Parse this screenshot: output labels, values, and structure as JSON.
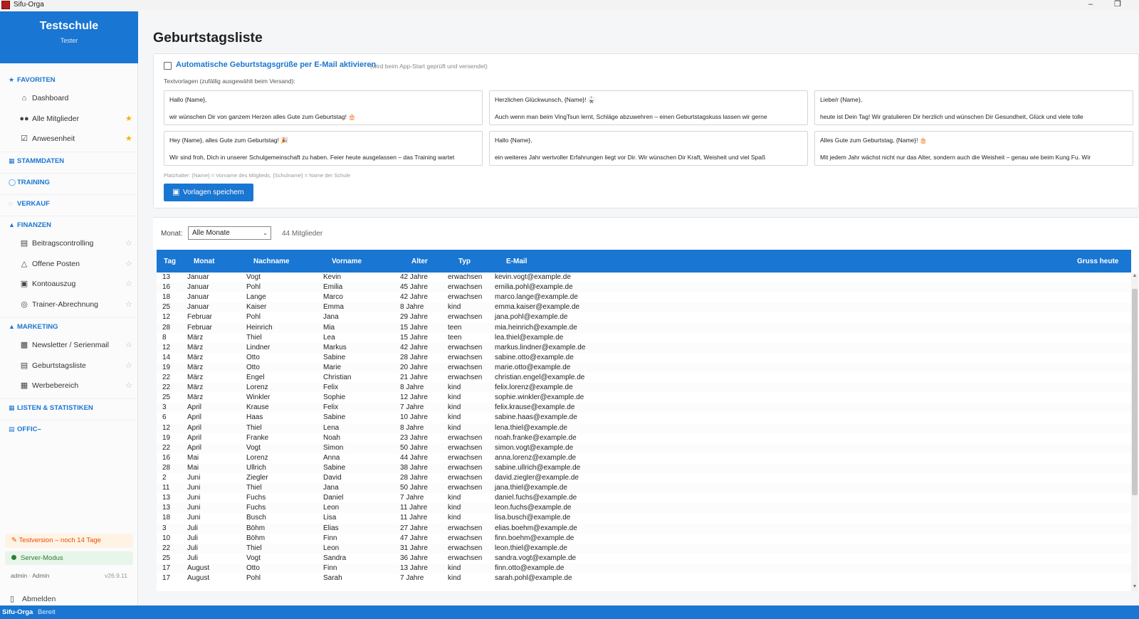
{
  "window": {
    "title": "Sifu-Orga"
  },
  "sidebar": {
    "school_name": "Testschule",
    "user_role": "Tester",
    "sections": {
      "favoriten": "FAVORITEN",
      "stammdaten": "STAMMDATEN",
      "training": "TRAINING",
      "verkauf": "VERKAUF",
      "finanzen": "FINANZEN",
      "marketing": "MARKETING",
      "listen": "LISTEN & STATISTIKEN",
      "office": "OFFIC–"
    },
    "favorites": [
      {
        "label": "Dashboard",
        "icon": "home-icon",
        "starred": false
      },
      {
        "label": "Alle Mitglieder",
        "icon": "users-icon",
        "starred": true
      },
      {
        "label": "Anwesenheit",
        "icon": "checkbox-icon",
        "starred": true
      }
    ],
    "finanzen_items": [
      {
        "label": "Beitragscontrolling",
        "icon": "card-icon"
      },
      {
        "label": "Offene Posten",
        "icon": "warning-icon"
      },
      {
        "label": "Kontoauszug",
        "icon": "statement-icon"
      },
      {
        "label": "Trainer-Abrechnung",
        "icon": "coin-icon"
      }
    ],
    "marketing_items": [
      {
        "label": "Newsletter / Serienmail",
        "icon": "newsletter-icon"
      },
      {
        "label": "Geburtstagsliste",
        "icon": "cake-icon"
      },
      {
        "label": "Werbebereich",
        "icon": "ad-icon"
      }
    ],
    "trial_text": "Testversion – noch 14 Tage",
    "server_text": "Server-Modus",
    "user_line": "admin · Admin",
    "version": "v26.9.11",
    "logout_label": "Abmelden"
  },
  "main": {
    "title": "Geburtstagsliste",
    "auto_greeting_label": "Automatische Geburtstagsgrüße per E-Mail aktivieren",
    "auto_greeting_hint": "(wird beim App-Start geprüft und versendet)",
    "auto_greeting_checked": false,
    "templates_label": "Textvorlagen (zufällig ausgewählt beim Versand):",
    "templates": [
      {
        "line1": "Hallo {Name},",
        "line2": "wir wünschen Dir von ganzem Herzen alles Gute zum Geburtstag! 🎂"
      },
      {
        "line1": "Herzlichen Glückwunsch, {Name}! 🥋",
        "line2": "Auch wenn man beim VingTsun lernt, Schläge abzuwehren – einen Geburtstagskuss lassen wir gerne"
      },
      {
        "line1": "Liebe/r {Name},",
        "line2": "heute ist Dein Tag! Wir gratulieren Dir herzlich und wünschen Dir Gesundheit, Glück und viele tolle"
      },
      {
        "line1": "Hey {Name}, alles Gute zum Geburtstag! 🎉",
        "line2": "Wir sind froh, Dich in unserer Schulgemeinschaft zu haben. Feier heute ausgelassen – das Training wartet"
      },
      {
        "line1": "Hallo {Name},",
        "line2": "ein weiteres Jahr wertvoller Erfahrungen liegt vor Dir. Wir wünschen Dir Kraft, Weisheit und viel Spaß"
      },
      {
        "line1": "Alles Gute zum Geburtstag, {Name}! 🎂",
        "line2": "Mit jedem Jahr wächst nicht nur das Alter, sondern auch die Weisheit – genau wie beim Kung Fu. Wir"
      }
    ],
    "placeholder_hint": "Platzhalter: {Name} = Vorname des Mitglieds, {Schulname} = Name der Schule",
    "save_button": "Vorlagen speichern",
    "filter": {
      "month_label": "Monat:",
      "month_value": "Alle Monate",
      "count": "44 Mitglieder"
    },
    "table": {
      "columns": [
        "Tag",
        "Monat",
        "Nachname",
        "Vorname",
        "Alter",
        "Typ",
        "E-Mail",
        "Gruss heute"
      ],
      "rows": [
        [
          "13",
          "Januar",
          "Vogt",
          "Kevin",
          "42 Jahre",
          "erwachsen",
          "kevin.vogt@example.de",
          ""
        ],
        [
          "16",
          "Januar",
          "Pohl",
          "Emilia",
          "45 Jahre",
          "erwachsen",
          "emilia.pohl@example.de",
          ""
        ],
        [
          "18",
          "Januar",
          "Lange",
          "Marco",
          "42 Jahre",
          "erwachsen",
          "marco.lange@example.de",
          ""
        ],
        [
          "25",
          "Januar",
          "Kaiser",
          "Emma",
          "8 Jahre",
          "kind",
          "emma.kaiser@example.de",
          ""
        ],
        [
          "12",
          "Februar",
          "Pohl",
          "Jana",
          "29 Jahre",
          "erwachsen",
          "jana.pohl@example.de",
          ""
        ],
        [
          "28",
          "Februar",
          "Heinrich",
          "Mia",
          "15 Jahre",
          "teen",
          "mia.heinrich@example.de",
          ""
        ],
        [
          "8",
          "März",
          "Thiel",
          "Lea",
          "15 Jahre",
          "teen",
          "lea.thiel@example.de",
          ""
        ],
        [
          "12",
          "März",
          "Lindner",
          "Markus",
          "42 Jahre",
          "erwachsen",
          "markus.lindner@example.de",
          ""
        ],
        [
          "14",
          "März",
          "Otto",
          "Sabine",
          "28 Jahre",
          "erwachsen",
          "sabine.otto@example.de",
          ""
        ],
        [
          "19",
          "März",
          "Otto",
          "Marie",
          "20 Jahre",
          "erwachsen",
          "marie.otto@example.de",
          ""
        ],
        [
          "22",
          "März",
          "Engel",
          "Christian",
          "21 Jahre",
          "erwachsen",
          "christian.engel@example.de",
          ""
        ],
        [
          "22",
          "März",
          "Lorenz",
          "Felix",
          "8 Jahre",
          "kind",
          "felix.lorenz@example.de",
          ""
        ],
        [
          "25",
          "März",
          "Winkler",
          "Sophie",
          "12 Jahre",
          "kind",
          "sophie.winkler@example.de",
          ""
        ],
        [
          "3",
          "April",
          "Krause",
          "Felix",
          "7 Jahre",
          "kind",
          "felix.krause@example.de",
          ""
        ],
        [
          "6",
          "April",
          "Haas",
          "Sabine",
          "10 Jahre",
          "kind",
          "sabine.haas@example.de",
          ""
        ],
        [
          "12",
          "April",
          "Thiel",
          "Lena",
          "8 Jahre",
          "kind",
          "lena.thiel@example.de",
          ""
        ],
        [
          "19",
          "April",
          "Franke",
          "Noah",
          "23 Jahre",
          "erwachsen",
          "noah.franke@example.de",
          ""
        ],
        [
          "22",
          "April",
          "Vogt",
          "Simon",
          "50 Jahre",
          "erwachsen",
          "simon.vogt@example.de",
          ""
        ],
        [
          "16",
          "Mai",
          "Lorenz",
          "Anna",
          "44 Jahre",
          "erwachsen",
          "anna.lorenz@example.de",
          ""
        ],
        [
          "28",
          "Mai",
          "Ullrich",
          "Sabine",
          "38 Jahre",
          "erwachsen",
          "sabine.ullrich@example.de",
          ""
        ],
        [
          "2",
          "Juni",
          "Ziegler",
          "David",
          "28 Jahre",
          "erwachsen",
          "david.ziegler@example.de",
          ""
        ],
        [
          "11",
          "Juni",
          "Thiel",
          "Jana",
          "50 Jahre",
          "erwachsen",
          "jana.thiel@example.de",
          ""
        ],
        [
          "13",
          "Juni",
          "Fuchs",
          "Daniel",
          "7 Jahre",
          "kind",
          "daniel.fuchs@example.de",
          ""
        ],
        [
          "13",
          "Juni",
          "Fuchs",
          "Leon",
          "11 Jahre",
          "kind",
          "leon.fuchs@example.de",
          ""
        ],
        [
          "18",
          "Juni",
          "Busch",
          "Lisa",
          "11 Jahre",
          "kind",
          "lisa.busch@example.de",
          ""
        ],
        [
          "3",
          "Juli",
          "Böhm",
          "Elias",
          "27 Jahre",
          "erwachsen",
          "elias.boehm@example.de",
          ""
        ],
        [
          "10",
          "Juli",
          "Böhm",
          "Finn",
          "47 Jahre",
          "erwachsen",
          "finn.boehm@example.de",
          ""
        ],
        [
          "22",
          "Juli",
          "Thiel",
          "Leon",
          "31 Jahre",
          "erwachsen",
          "leon.thiel@example.de",
          ""
        ],
        [
          "25",
          "Juli",
          "Vogt",
          "Sandra",
          "36 Jahre",
          "erwachsen",
          "sandra.vogt@example.de",
          ""
        ],
        [
          "17",
          "August",
          "Otto",
          "Finn",
          "13 Jahre",
          "kind",
          "finn.otto@example.de",
          ""
        ],
        [
          "17",
          "August",
          "Pohl",
          "Sarah",
          "7 Jahre",
          "kind",
          "sarah.pohl@example.de",
          ""
        ]
      ]
    }
  },
  "statusbar": {
    "app": "Sifu-Orga",
    "status": "Bereit"
  },
  "colors": {
    "accent": "#1976d2",
    "star": "#f5b400",
    "trial": "#e65100",
    "server": "#2e7d32"
  }
}
